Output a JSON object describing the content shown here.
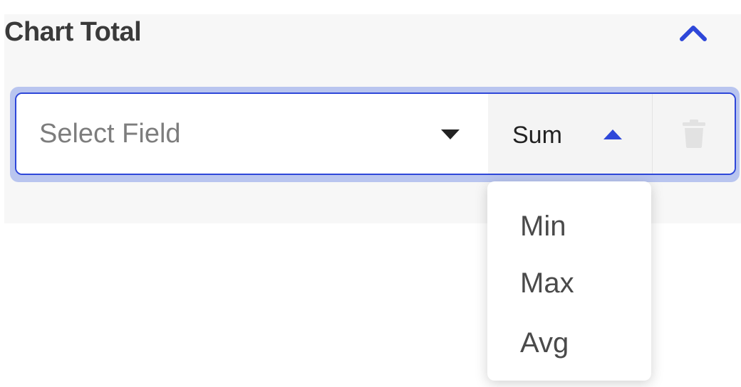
{
  "panel": {
    "title": "Chart Total",
    "collapse_icon": "chevron-up-icon"
  },
  "field_select": {
    "placeholder": "Select Field",
    "caret_icon": "caret-down-icon"
  },
  "aggregation": {
    "selected": "Sum",
    "caret_icon": "caret-up-icon",
    "options": [
      "Min",
      "Max",
      "Avg"
    ]
  },
  "delete": {
    "icon": "trash-icon"
  },
  "colors": {
    "accent": "#2e47d9",
    "focus_ring": "#b9c5ef",
    "panel_bg": "#f7f7f7",
    "disabled_icon": "#e2e2e2"
  }
}
